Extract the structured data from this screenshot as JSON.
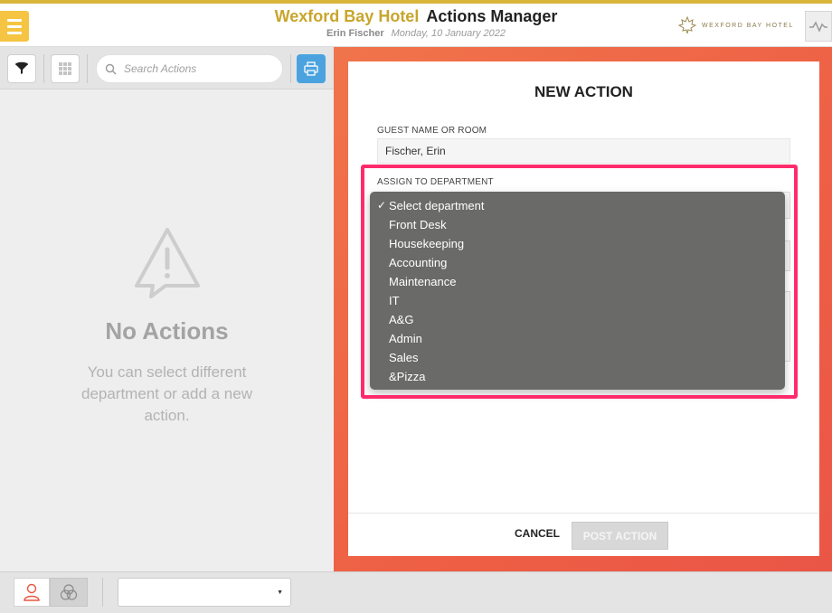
{
  "header": {
    "hotel_name": "Wexford Bay Hotel",
    "app_title": "Actions Manager",
    "user_name": "Erin Fischer",
    "date": "Monday, 10 January 2022",
    "logo_text": "WEXFORD BAY HOTEL"
  },
  "toolbar": {
    "search_placeholder": "Search Actions"
  },
  "empty_state": {
    "title": "No Actions",
    "message": "You can select different department or add a new action."
  },
  "form": {
    "title": "NEW ACTION",
    "guest_label": "GUEST NAME OR ROOM",
    "guest_value": "Fischer, Erin",
    "department_label": "ASSIGN TO DEPARTMENT",
    "cancel_label": "CANCEL",
    "post_label": "POST ACTION"
  },
  "department_dropdown": {
    "options": [
      {
        "label": "Select department",
        "checked": true
      },
      {
        "label": "Front Desk",
        "checked": false
      },
      {
        "label": "Housekeeping",
        "checked": false
      },
      {
        "label": "Accounting",
        "checked": false
      },
      {
        "label": "Maintenance",
        "checked": false
      },
      {
        "label": "IT",
        "checked": false
      },
      {
        "label": "A&G",
        "checked": false
      },
      {
        "label": "Admin",
        "checked": false
      },
      {
        "label": "Sales",
        "checked": false
      },
      {
        "label": "&Pizza",
        "checked": false
      }
    ]
  },
  "colors": {
    "brand_gold": "#c8a52c",
    "accent_orange": "#ee5f45",
    "highlight_pink": "#ff2b6b",
    "print_blue": "#4aa3df"
  }
}
